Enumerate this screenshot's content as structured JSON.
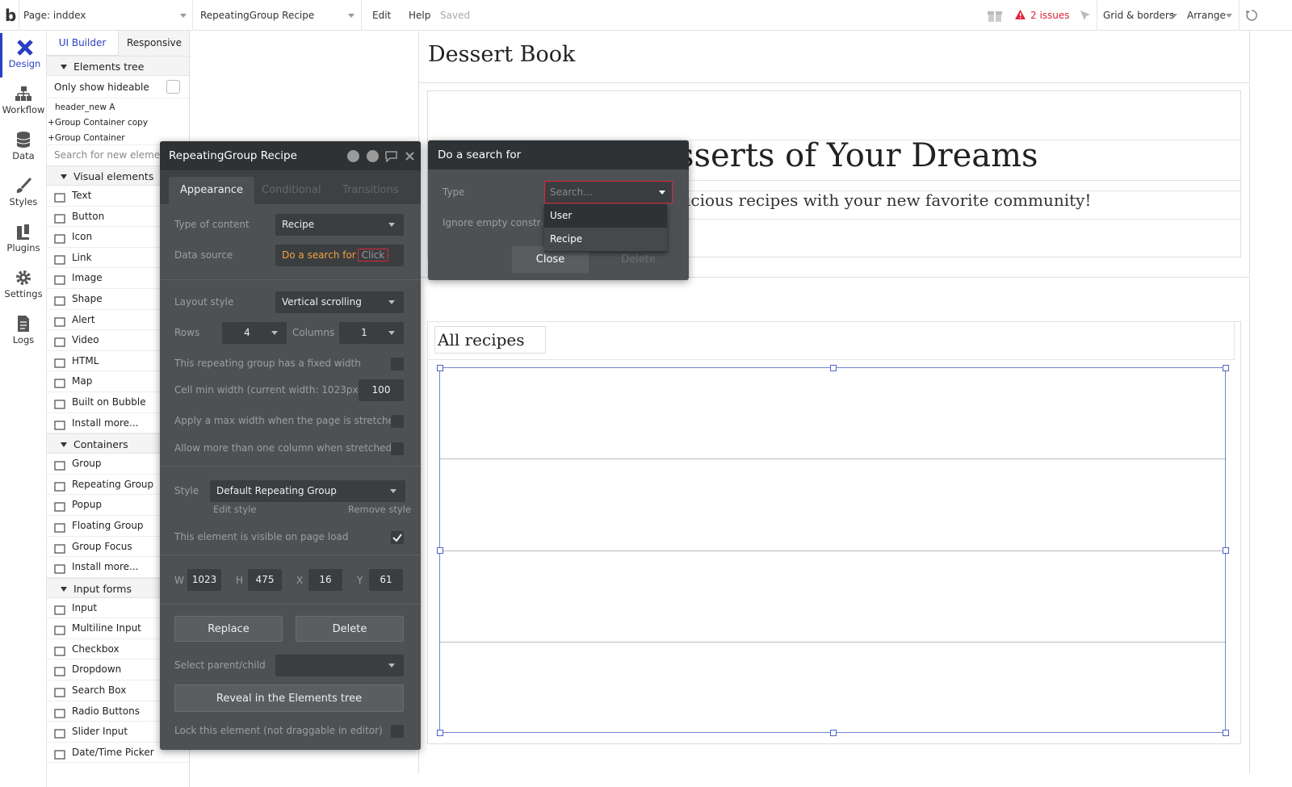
{
  "topbar": {
    "logo": "b",
    "page_label": "Page: inddex",
    "element_select": "RepeatingGroup Recipe",
    "edit": "Edit",
    "help": "Help",
    "saved": "Saved",
    "issues": "2 issues",
    "grid": "Grid & borders",
    "arrange": "Arrange"
  },
  "leftnav": {
    "items": [
      {
        "label": "Design",
        "icon": "design-icon"
      },
      {
        "label": "Workflow",
        "icon": "workflow-icon"
      },
      {
        "label": "Data",
        "icon": "database-icon"
      },
      {
        "label": "Styles",
        "icon": "brush-icon"
      },
      {
        "label": "Plugins",
        "icon": "plug-icon"
      },
      {
        "label": "Settings",
        "icon": "gear-icon"
      },
      {
        "label": "Logs",
        "icon": "document-icon"
      }
    ]
  },
  "palette": {
    "tabs": [
      "UI Builder",
      "Responsive"
    ],
    "elements_tree": "Elements tree",
    "only_hideable": "Only show hideable",
    "tree": [
      "header_new A",
      "Group Container copy",
      "Group Container"
    ],
    "search_placeholder": "Search for new elements...",
    "visual_title": "Visual elements",
    "visual": [
      "Text",
      "Button",
      "Icon",
      "Link",
      "Image",
      "Shape",
      "Alert",
      "Video",
      "HTML",
      "Map",
      "Built on Bubble",
      "Install more..."
    ],
    "containers_title": "Containers",
    "containers": [
      "Group",
      "Repeating Group",
      "Popup",
      "Floating Group",
      "Group Focus",
      "Install more..."
    ],
    "inputs_title": "Input forms",
    "inputs": [
      "Input",
      "Multiline Input",
      "Checkbox",
      "Dropdown",
      "Search Box",
      "Radio Buttons",
      "Slider Input",
      "Date/Time Picker"
    ]
  },
  "page": {
    "title": "Dessert Book",
    "hero_title": "sserts of Your Dreams",
    "hero_sub": "icious recipes with your new favorite community!",
    "all_recipes": "All recipes"
  },
  "editor": {
    "title": "RepeatingGroup Recipe",
    "tabs": [
      "Appearance",
      "Conditional",
      "Transitions"
    ],
    "type_label": "Type of content",
    "type_value": "Recipe",
    "source_label": "Data source",
    "source_value": "Do a search for",
    "source_click": "Click",
    "layout_label": "Layout style",
    "layout_value": "Vertical scrolling",
    "rows_label": "Rows",
    "rows_value": "4",
    "cols_label": "Columns",
    "cols_value": "1",
    "fixed_width": "This repeating group has a fixed width",
    "cell_min_label": "Cell min width (current width: 1023px)",
    "cell_min_value": "100",
    "max_width": "Apply a max width when the page is stretched",
    "multi_col": "Allow more than one column when stretched",
    "style_label": "Style",
    "style_value": "Default Repeating Group",
    "edit_style": "Edit style",
    "remove_style": "Remove style",
    "visible_label": "This element is visible on page load",
    "w_label": "W",
    "w": "1023",
    "h_label": "H",
    "h": "475",
    "x_label": "X",
    "x": "16",
    "y_label": "Y",
    "y": "61",
    "replace": "Replace",
    "delete": "Delete",
    "parent_label": "Select parent/child",
    "reveal": "Reveal in the Elements tree",
    "lock": "Lock this element (not draggable in editor)"
  },
  "search_popup": {
    "title": "Do a search for",
    "type_label": "Type",
    "type_placeholder": "Search...",
    "ignore_label": "Ignore empty constrain",
    "options": [
      "User",
      "Recipe"
    ],
    "close": "Close",
    "delete": "Delete"
  },
  "colors": {
    "accent": "#2b3ec4",
    "issues_red": "#e0243a",
    "panel_dark": "#4e5154",
    "orange": "#f0a23c"
  }
}
